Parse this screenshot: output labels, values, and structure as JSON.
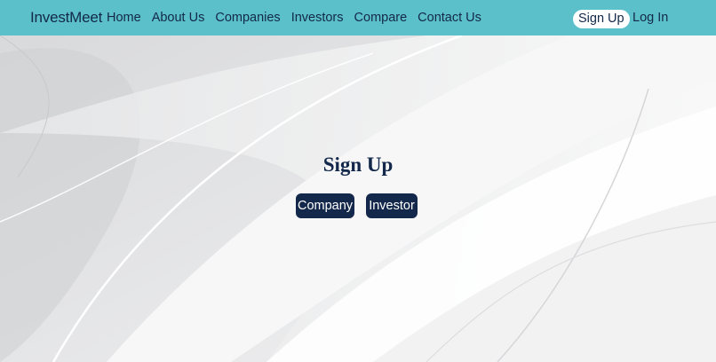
{
  "nav": {
    "brand": "InvestMeet",
    "links": [
      "Home",
      "About Us",
      "Companies",
      "Investors",
      "Compare",
      "Contact Us"
    ],
    "signup": "Sign Up",
    "login": "Log In"
  },
  "main": {
    "heading": "Sign Up",
    "buttons": {
      "company": "Company",
      "investor": "Investor"
    }
  },
  "colors": {
    "navbar": "#5bc0c9",
    "text_dark": "#13284a",
    "button_bg": "#13284a",
    "background": "#eeeeef"
  }
}
